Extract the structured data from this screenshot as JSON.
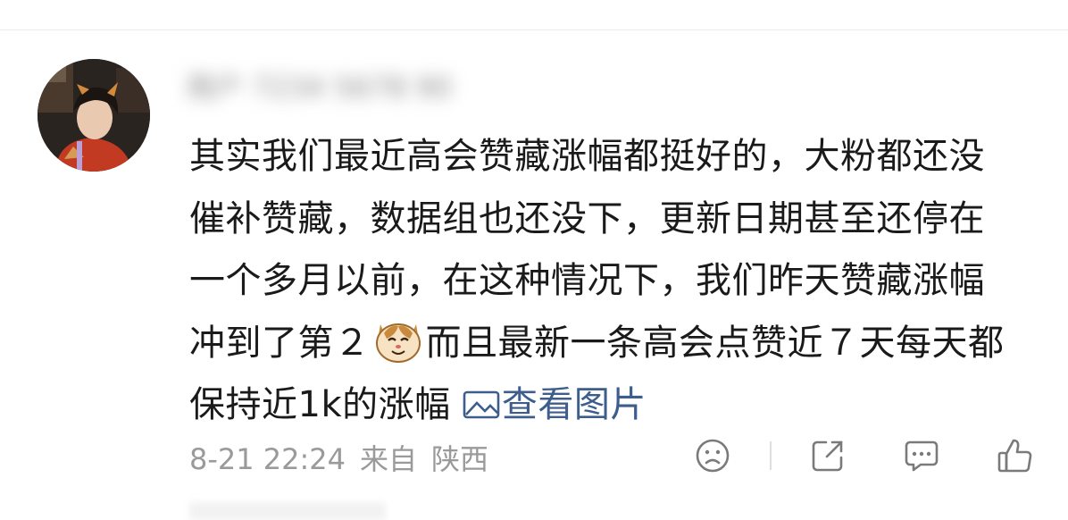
{
  "comment": {
    "username": "用户 7234 5678 90",
    "text": "其实我们最近高会赞藏涨幅都挺好的，大粉都还没催补赞藏，数据组也还没下，更新日期甚至还停在一个多月以前，在这种情况下，我们昨天赞藏涨幅冲到了第２",
    "text_after_emoji": "而且最新一条高会点赞近７天每天都保持近1k的涨幅",
    "emoji": "cat-face-emoji",
    "view_images_label": "查看图片",
    "date": "8-21 22:24",
    "source_prefix": "来自",
    "location": "陕西"
  },
  "actions": {
    "dislike": "frown-face-icon",
    "share": "share-icon",
    "reply": "comment-bubble-icon",
    "like": "thumbs-up-icon"
  },
  "colors": {
    "link": "#3d5d8c",
    "meta": "#9a9a9a",
    "text": "#1a1a1a"
  }
}
